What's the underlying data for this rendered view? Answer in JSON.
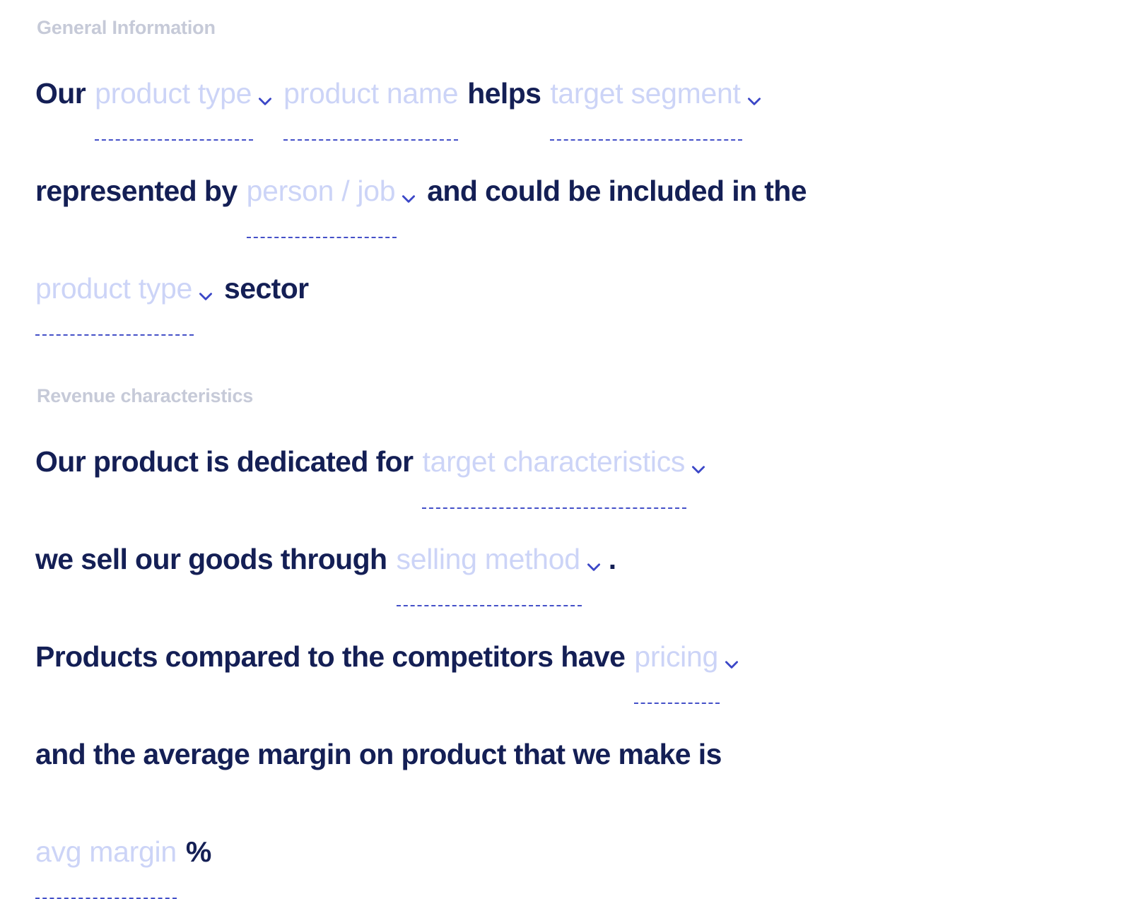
{
  "page": {
    "background": "#ffffff",
    "text_color": "#141f55",
    "placeholder_color": "#ccd4f7",
    "section_label_color": "#c6cad8",
    "rule_color": "#4450c8",
    "chevron_color": "#3b47c7"
  },
  "sections": [
    {
      "label": "General Information",
      "lines": [
        {
          "parts": [
            {
              "kind": "text",
              "value": "Our"
            },
            {
              "kind": "field",
              "placeholder": "product type",
              "control": "dropdown",
              "icon": "chevron-down-icon",
              "name": "product-type-1"
            },
            {
              "kind": "field",
              "placeholder": "product name",
              "control": "text",
              "icon": null,
              "name": "product-name"
            },
            {
              "kind": "text",
              "value": "helps"
            },
            {
              "kind": "field",
              "placeholder": "target segment",
              "control": "dropdown",
              "icon": "chevron-down-icon",
              "name": "target-segment"
            }
          ]
        },
        {
          "parts": [
            {
              "kind": "text",
              "value": "represented by"
            },
            {
              "kind": "field",
              "placeholder": "person / job",
              "control": "dropdown",
              "icon": "chevron-down-icon",
              "name": "person-job"
            },
            {
              "kind": "text",
              "value": "and could be included in the"
            }
          ]
        },
        {
          "parts": [
            {
              "kind": "field",
              "placeholder": "product type",
              "control": "dropdown",
              "icon": "chevron-down-icon",
              "name": "product-type-2"
            },
            {
              "kind": "text",
              "value": "sector"
            }
          ]
        }
      ]
    },
    {
      "label": "Revenue characteristics",
      "lines": [
        {
          "parts": [
            {
              "kind": "text",
              "value": "Our product is dedicated for"
            },
            {
              "kind": "field",
              "placeholder": "target characteristics",
              "control": "dropdown",
              "icon": "chevron-down-icon",
              "name": "target-characteristics"
            }
          ]
        },
        {
          "parts": [
            {
              "kind": "text",
              "value": "we sell our goods through"
            },
            {
              "kind": "field",
              "placeholder": "selling method",
              "control": "dropdown",
              "icon": "chevron-down-icon",
              "name": "selling-method"
            },
            {
              "kind": "punct",
              "value": "."
            }
          ]
        },
        {
          "parts": [
            {
              "kind": "text",
              "value": "Products compared to the competitors have"
            },
            {
              "kind": "field",
              "placeholder": "pricing",
              "control": "dropdown",
              "icon": "chevron-down-icon",
              "name": "pricing"
            }
          ]
        },
        {
          "parts": [
            {
              "kind": "text",
              "value": "and the average margin on product that we make is"
            }
          ]
        },
        {
          "parts": [
            {
              "kind": "field",
              "placeholder": "avg margin",
              "control": "text",
              "icon": null,
              "name": "avg-margin"
            },
            {
              "kind": "text",
              "value": "%"
            }
          ]
        }
      ]
    }
  ]
}
